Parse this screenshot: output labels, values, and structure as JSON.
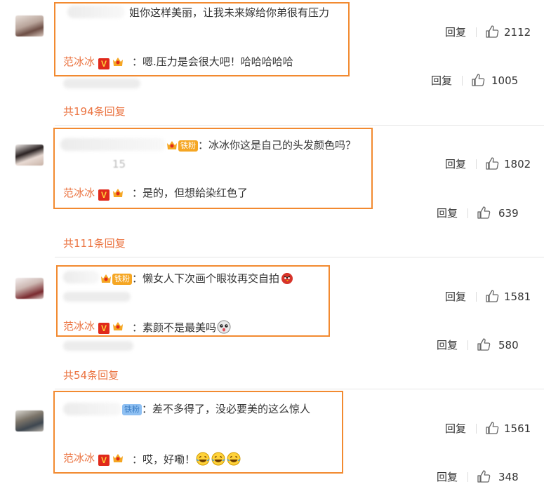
{
  "actions": {
    "reply_label": "回复"
  },
  "comments": [
    {
      "text": "姐你这样美丽，让我未来嫁给你弟很有压力",
      "likes": "2112",
      "reply": {
        "author": "范冰冰",
        "text": "：嗯.压力是会很大吧！哈哈哈哈哈",
        "likes": "1005"
      },
      "total": "共194条回复"
    },
    {
      "fan_badge": "铁粉",
      "text": "：冰冰你这是自己的头发颜色吗？",
      "faded_time": "15",
      "likes": "1802",
      "reply": {
        "author": "范冰冰",
        "text": "：是的，但想給染红色了",
        "likes": "639"
      },
      "total": "共111条回复"
    },
    {
      "fan_badge": "铁粉",
      "text": "：懒女人下次画个眼妆再交自拍",
      "likes": "1581",
      "reply": {
        "author": "范冰冰",
        "text": "：素颜不是最美吗",
        "likes": "580"
      },
      "total": "共54条回复"
    },
    {
      "fan_badge": "铁粉",
      "text": "：差不多得了，没必要美的这么惊人",
      "likes": "1561",
      "reply": {
        "author": "范冰冰",
        "text": "：哎，好嘞！",
        "likes": "348"
      }
    }
  ],
  "icons": {
    "like": "thumbs-up-icon",
    "verified": "verified-v-icon",
    "crown": "crown-badge-icon"
  },
  "colors": {
    "highlight_box": "#f28a30",
    "link": "#eb7340",
    "verified": "#e0291b"
  }
}
